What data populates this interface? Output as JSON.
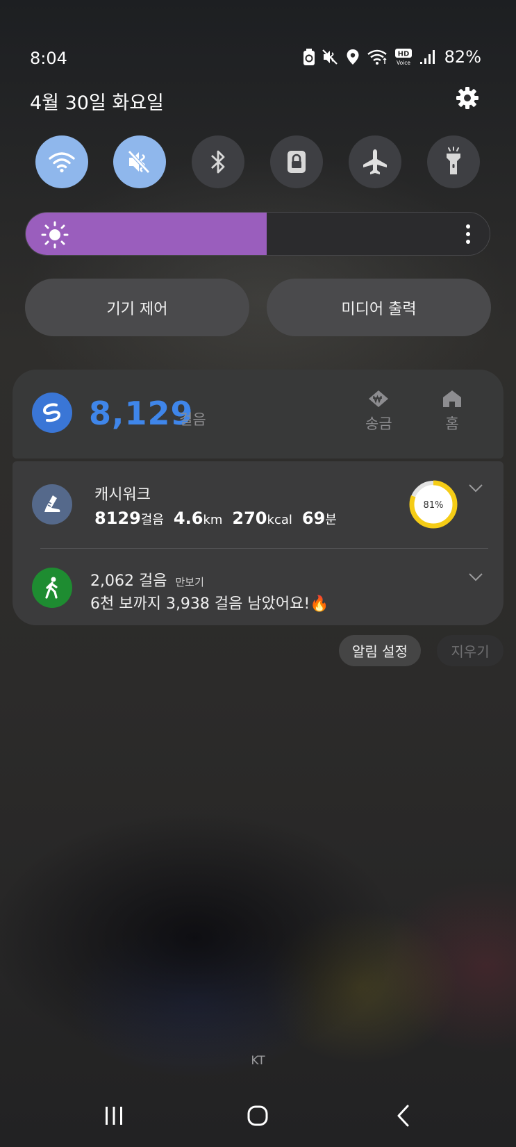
{
  "status_bar": {
    "time": "8:04",
    "battery_percent": "82%",
    "icons": [
      "battery-saver-icon",
      "mute-icon",
      "location-icon",
      "wifi-icon",
      "hd-voice-icon",
      "signal-icon"
    ],
    "hd_label": "HD",
    "voice_label": "Voice"
  },
  "header": {
    "date": "4월 30일 화요일",
    "settings_icon": "gear-icon"
  },
  "quick_toggles": [
    {
      "name": "wifi",
      "icon": "wifi-icon",
      "on": true
    },
    {
      "name": "sound",
      "icon": "mute-icon",
      "on": true
    },
    {
      "name": "bluetooth",
      "icon": "bluetooth-icon",
      "on": false
    },
    {
      "name": "rotation-lock",
      "icon": "lock-icon",
      "on": false
    },
    {
      "name": "airplane",
      "icon": "airplane-icon",
      "on": false
    },
    {
      "name": "flashlight",
      "icon": "flashlight-icon",
      "on": false
    }
  ],
  "brightness": {
    "level": 0.52,
    "color": "#9a5ebd"
  },
  "buttons": {
    "device_control": "기기 제어",
    "media_output": "미디어 출력"
  },
  "samsung_pay": {
    "steps": "8,129",
    "steps_unit": "걸음",
    "send_label": "송금",
    "home_label": "홈"
  },
  "cashwalk": {
    "title": "캐시워크",
    "steps": "8129",
    "steps_unit": "걸음",
    "distance": "4.6",
    "distance_unit": "km",
    "calories": "270",
    "calories_unit": "kcal",
    "minutes": "69",
    "minutes_unit": "분",
    "progress_label": "81%",
    "progress": 0.81,
    "progress_color": "#f5cc16"
  },
  "pedometer": {
    "title": "2,062 걸음",
    "app_name": "만보기",
    "message": "6천 보까지 3,938 걸음 남았어요!🔥"
  },
  "notification_actions": {
    "settings": "알림 설정",
    "clear": "지우기"
  },
  "carrier": "KT",
  "colors": {
    "accent_blue": "#3f86ea",
    "toggle_on": "#8fb7ec",
    "toggle_off": "#3e3f43"
  }
}
